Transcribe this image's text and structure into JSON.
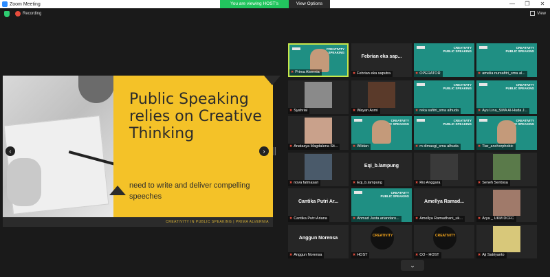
{
  "window": {
    "title": "Zoom Meeting",
    "minimize": "—",
    "maximize": "❐",
    "close": "✕"
  },
  "share_banner": {
    "viewing": "You are viewing HOST's screen",
    "view_options": "View Options ⌄"
  },
  "toolbar": {
    "recording": "Recording",
    "view_label": "View"
  },
  "slide": {
    "headline": "Public Speaking relies on Creative Thinking",
    "subline": "need to write and deliver compelling speeches",
    "footer": "CREATIVITY IN PUBLIC SPEAKING | PRIMA ALVERNIA",
    "prev_label": "‹",
    "next_label": "›"
  },
  "gallery": {
    "scroll_down": "⌄",
    "brand_text": "CREATIVITY\nPUBLIC SPEAKING",
    "co_text": "CREATIVITY",
    "tiles": [
      {
        "label": "Prima Alvernia",
        "kind": "teal-person",
        "active": true
      },
      {
        "label": "Febrian eka saputra",
        "kind": "name",
        "big": "Febrian eka sap..."
      },
      {
        "label": "OPERATOR",
        "kind": "teal"
      },
      {
        "label": "amelia nursafitri_sma al...",
        "kind": "teal"
      },
      {
        "label": "Syahrial",
        "kind": "photo",
        "color": "#8a8a8a"
      },
      {
        "label": "Wayan Asmi",
        "kind": "photo",
        "color": "#5a3a2a"
      },
      {
        "label": "reka safitri_sma alhuda",
        "kind": "teal"
      },
      {
        "label": "Ayu Lina_SMA Al-Huda J...",
        "kind": "teal"
      },
      {
        "label": "Anatasya Magdalena Sit...",
        "kind": "photo",
        "color": "#c9a18b"
      },
      {
        "label": "Wildan",
        "kind": "teal-person"
      },
      {
        "label": "m dimasgi_sma alhuda",
        "kind": "teal"
      },
      {
        "label": "Tiar_anchorphobic",
        "kind": "teal-person"
      },
      {
        "label": "nova fatmasari",
        "kind": "photo",
        "color": "#4a5a6a"
      },
      {
        "label": "Eqi_b.lampung",
        "kind": "name",
        "big": "Eqi_b.lampung"
      },
      {
        "label": "Rio Anggara",
        "kind": "photo",
        "color": "#3a3a3a"
      },
      {
        "label": "Seneh Sentosa",
        "kind": "photo",
        "color": "#5a7a4a"
      },
      {
        "label": "Cantika Putri Ariana",
        "kind": "name",
        "big": "Cantika Putri Ar..."
      },
      {
        "label": "Ahmad Justa ariandaro...",
        "kind": "teal"
      },
      {
        "label": "Amellya Ramadhani_uk...",
        "kind": "name",
        "big": "Amellya Ramad..."
      },
      {
        "label": "Arya _ UKM DCFC",
        "kind": "photo",
        "color": "#a07a6a"
      },
      {
        "label": "Anggun Norensa",
        "kind": "name",
        "big": "Anggun Norensa"
      },
      {
        "label": "HOST",
        "kind": "circle"
      },
      {
        "label": "CO - HOST",
        "kind": "circle"
      },
      {
        "label": "Aji Satriyanto",
        "kind": "photo",
        "color": "#d8c87a"
      }
    ]
  }
}
